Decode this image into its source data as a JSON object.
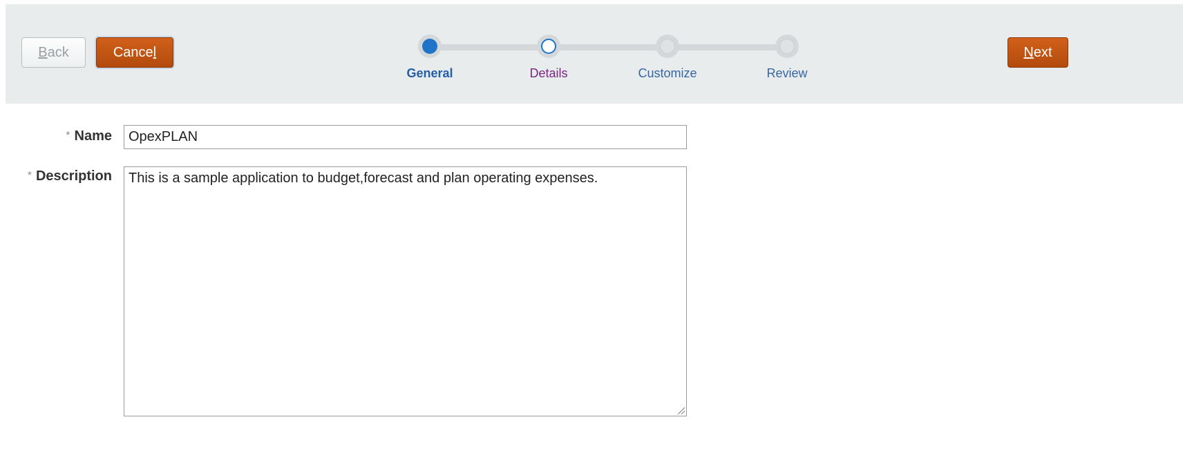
{
  "toolbar": {
    "back_label_accel": "B",
    "back_label_rest": "ack",
    "cancel_label_main": "Cance",
    "cancel_label_accel": "l",
    "next_label_accel": "N",
    "next_label_rest": "ext"
  },
  "train": {
    "stops": [
      {
        "label": "General",
        "state": "current"
      },
      {
        "label": "Details",
        "state": "visited"
      },
      {
        "label": "Customize",
        "state": "unvisited"
      },
      {
        "label": "Review",
        "state": "unvisited"
      }
    ]
  },
  "form": {
    "required_marker": "*",
    "name": {
      "label": "Name",
      "value": "OpexPLAN"
    },
    "description": {
      "label": "Description",
      "value": "This is a sample application to budget,forecast and plan operating expenses."
    }
  },
  "colors": {
    "accent_orange": "#c2561a",
    "train_blue": "#1f74c7",
    "visited_purple": "#7b2582",
    "bar_background": "#e9eced"
  },
  "icons": {
    "resize_grip": "resize-grip-icon"
  }
}
